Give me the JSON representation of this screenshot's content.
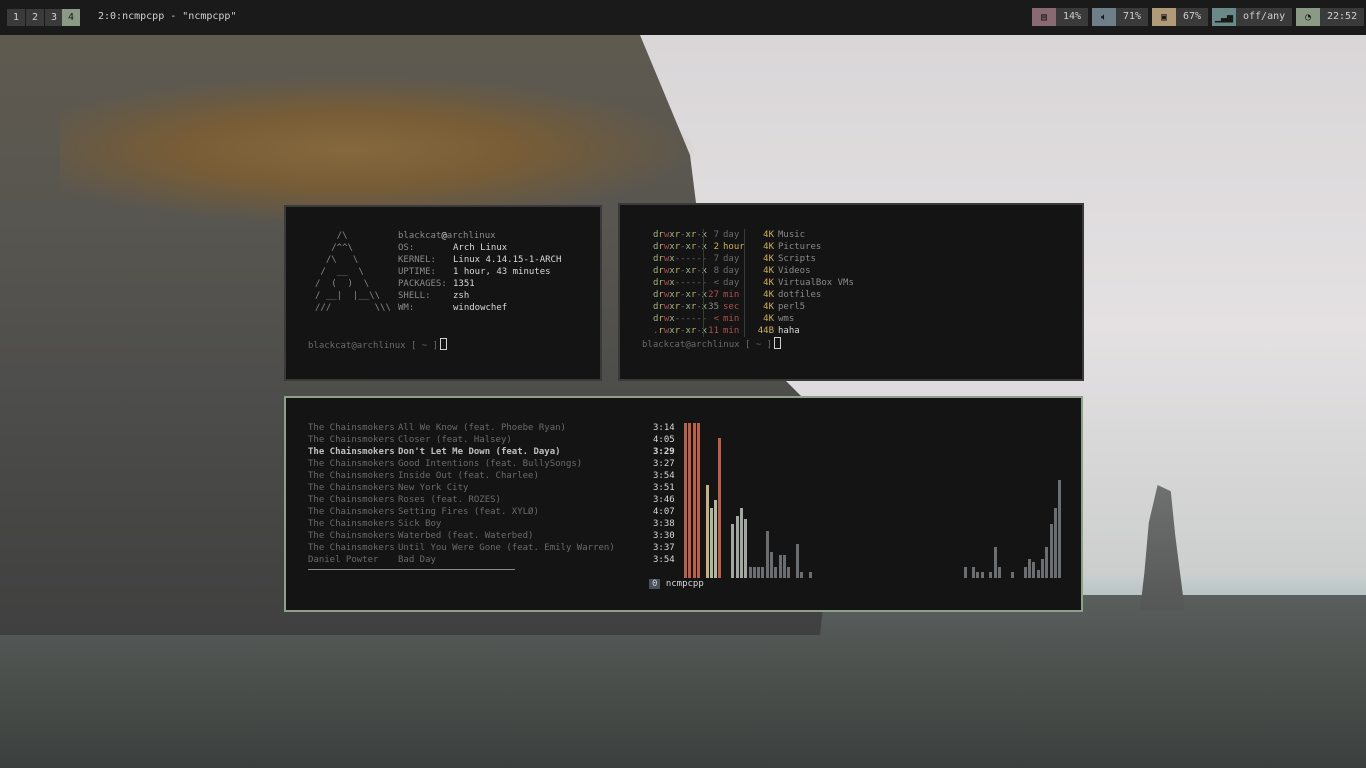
{
  "topbar": {
    "workspaces": [
      "1",
      "2",
      "3",
      "4"
    ],
    "active_workspace": "4",
    "window_title": "2:0:ncmpcpp - \"ncmpcpp\"",
    "status": [
      {
        "icon": "memory-icon",
        "value": "14%",
        "color": "#8a6a72"
      },
      {
        "icon": "volume-icon",
        "value": "71%",
        "color": "#6f7f8a"
      },
      {
        "icon": "battery-icon",
        "value": "67%",
        "color": "#b09a78"
      },
      {
        "icon": "signal-icon",
        "value": "off/any",
        "color": "#6a8a8a"
      },
      {
        "icon": "clock-icon",
        "value": "22:52",
        "color": "#8a9a85"
      }
    ]
  },
  "fetch": {
    "user": "blackcat",
    "host": "archlinux",
    "rows": [
      {
        "key": "OS:",
        "value": "Arch Linux"
      },
      {
        "key": "KERNEL:",
        "value": "Linux 4.14.15-1-ARCH"
      },
      {
        "key": "UPTIME:",
        "value": "1 hour, 43 minutes"
      },
      {
        "key": "PACKAGES:",
        "value": "1351"
      },
      {
        "key": "SHELL:",
        "value": "zsh"
      },
      {
        "key": "WM:",
        "value": "windowchef"
      }
    ],
    "ascii": [
      "    /\\",
      "   /^^\\",
      "  /\\   \\",
      " /  __  \\",
      "/  (  )  \\",
      "/ __|  |__\\\\",
      "///        \\\\\\"
    ],
    "prompt": "blackcat@archlinux [ ~ ]"
  },
  "listing": {
    "rows": [
      {
        "perm": "drwxr-xr-x",
        "age_n": "7",
        "age_u": "day",
        "size": "4K",
        "name": "Music",
        "fresh": false
      },
      {
        "perm": "drwxr-xr-x",
        "age_n": "2",
        "age_u": "hour",
        "size": "4K",
        "name": "Pictures",
        "fresh": "hour"
      },
      {
        "perm": "drwx------",
        "age_n": "7",
        "age_u": "day",
        "size": "4K",
        "name": "Scripts",
        "fresh": false
      },
      {
        "perm": "drwxr-xr-x",
        "age_n": "8",
        "age_u": "day",
        "size": "4K",
        "name": "Videos",
        "fresh": false
      },
      {
        "perm": "drwx------",
        "age_n": "<",
        "age_u": "day",
        "size": "4K",
        "name": "VirtualBox VMs",
        "fresh": false
      },
      {
        "perm": "drwxr-xr-x",
        "age_n": "27",
        "age_u": "min",
        "size": "4K",
        "name": "dotfiles",
        "fresh": "min"
      },
      {
        "perm": "drwxr-xr-x",
        "age_n": "35",
        "age_u": "sec",
        "size": "4K",
        "name": "perl5",
        "fresh": "sec"
      },
      {
        "perm": "drwx------",
        "age_n": "<",
        "age_u": "min",
        "size": "4K",
        "name": "wms",
        "fresh": "min"
      },
      {
        "perm": ".rwxr-xr-x",
        "age_n": "11",
        "age_u": "min",
        "size": "44B",
        "name": "haha",
        "fresh": "min"
      }
    ],
    "prompt": "blackcat@archlinux [ ~ ]"
  },
  "player": {
    "tracks": [
      {
        "artist": "The Chainsmokers",
        "title": "All We Know (feat. Phoebe Ryan)",
        "time": "3:14"
      },
      {
        "artist": "The Chainsmokers",
        "title": "Closer (feat. Halsey)",
        "time": "4:05"
      },
      {
        "artist": "The Chainsmokers",
        "title": "Don't Let Me Down (feat. Daya)",
        "time": "3:29",
        "playing": true
      },
      {
        "artist": "The Chainsmokers",
        "title": "Good Intentions (feat. BullySongs)",
        "time": "3:27"
      },
      {
        "artist": "The Chainsmokers",
        "title": "Inside Out (feat. Charlee)",
        "time": "3:54"
      },
      {
        "artist": "The Chainsmokers",
        "title": "New York City",
        "time": "3:51"
      },
      {
        "artist": "The Chainsmokers",
        "title": "Roses (feat. ROZES)",
        "time": "3:46"
      },
      {
        "artist": "The Chainsmokers",
        "title": "Setting Fires (feat. XYLØ)",
        "time": "4:07"
      },
      {
        "artist": "The Chainsmokers",
        "title": "Sick Boy",
        "time": "3:38"
      },
      {
        "artist": "The Chainsmokers",
        "title": "Waterbed (feat. Waterbed)",
        "time": "3:30"
      },
      {
        "artist": "The Chainsmokers",
        "title": "Until You Were Gone (feat. Emily Warren)",
        "time": "3:37"
      },
      {
        "artist": "Daniel Powter",
        "title": "Bad Day",
        "time": "3:54"
      }
    ],
    "tab_index": "0",
    "tab_label": "ncmpcpp",
    "visualizer": [
      1.0,
      1.0,
      1.0,
      1.0,
      0.0,
      0.6,
      0.45,
      0.5,
      0.9,
      0.0,
      0.0,
      0.35,
      0.4,
      0.45,
      0.38,
      0.07,
      0.07,
      0.07,
      0.07,
      0.3,
      0.17,
      0.07,
      0.15,
      0.15,
      0.07,
      0.0,
      0.22,
      0.04,
      0.0,
      0.04,
      0.0,
      0.0,
      0.0,
      0.0,
      0.0,
      0.0,
      0.0,
      0.0,
      0.0,
      0.0,
      0.0,
      0.0,
      0.0,
      0.0,
      0.0,
      0.0,
      0.0,
      0.0,
      0.0,
      0.0,
      0.0,
      0.0,
      0.0,
      0.0,
      0.0,
      0.0,
      0.0,
      0.0,
      0.0,
      0.0,
      0.0,
      0.0,
      0.0,
      0.0,
      0.0,
      0.07,
      0.0,
      0.07,
      0.04,
      0.04,
      0.0,
      0.04,
      0.2,
      0.07,
      0.0,
      0.0,
      0.04,
      0.0,
      0.0,
      0.07,
      0.12,
      0.1,
      0.05,
      0.12,
      0.2,
      0.35,
      0.45,
      0.63
    ]
  }
}
